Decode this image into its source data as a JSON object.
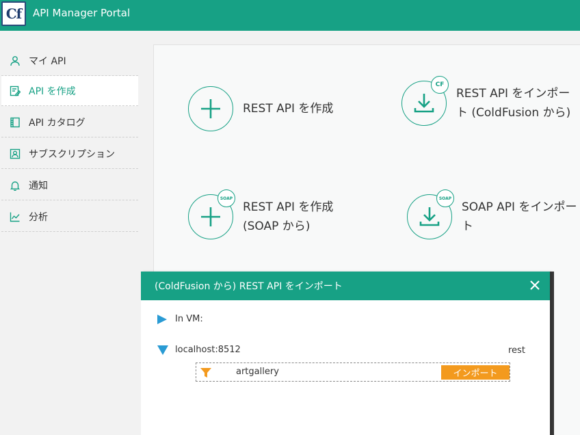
{
  "header": {
    "logo_text": "Cf",
    "title": "API Manager Portal",
    "color": "#17a185"
  },
  "sidebar": {
    "items": [
      {
        "label": "マイ API",
        "icon": "user-icon",
        "active": false
      },
      {
        "label": "API を作成",
        "icon": "edit-icon",
        "active": true
      },
      {
        "label": "API カタログ",
        "icon": "catalog-icon",
        "active": false
      },
      {
        "label": "サブスクリプション",
        "icon": "subscription-icon",
        "active": false
      },
      {
        "label": "通知",
        "icon": "bell-icon",
        "active": false
      },
      {
        "label": "分析",
        "icon": "chart-icon",
        "active": false
      }
    ]
  },
  "main": {
    "tiles": [
      {
        "label": "REST API を作成",
        "icon": "plus-icon"
      },
      {
        "label": "REST API をインポート (ColdFusion から)",
        "icon": "download-icon",
        "badge": "CF"
      },
      {
        "label": "REST API を作成 (SOAP から)",
        "icon": "plus-icon",
        "badge": "SOAP"
      },
      {
        "label": "SOAP API をインポート",
        "icon": "download-icon",
        "badge": "SOAP"
      }
    ]
  },
  "dialog": {
    "title": "(ColdFusion から) REST API をインポート",
    "tree": {
      "in_vm_label": "In VM:",
      "host_label": "localhost:8512",
      "rest_label": "rest",
      "api_name": "artgallery",
      "import_label": "インポート"
    },
    "colors": {
      "accent": "#17a185",
      "import": "#f39a1e",
      "triangle": "#2a9bd4",
      "filter": "#f39a1e"
    }
  }
}
